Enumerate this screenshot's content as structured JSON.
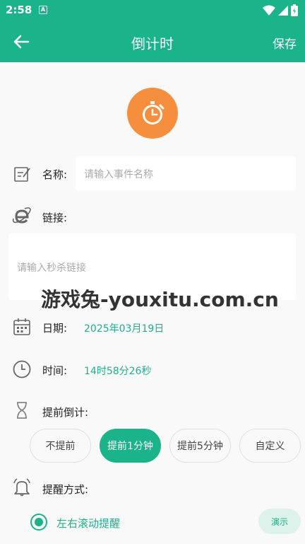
{
  "status_bar": {
    "time": "2:58",
    "notification_glyph": "A",
    "icons": [
      "wifi-icon",
      "signal-icon",
      "battery-icon"
    ]
  },
  "toolbar": {
    "title": "倒计时",
    "save_label": "保存"
  },
  "form": {
    "name": {
      "label": "名称:",
      "placeholder": "请输入事件名称"
    },
    "link": {
      "label": "链接:",
      "placeholder": "请输入秒杀链接"
    },
    "date": {
      "label": "日期:",
      "value": "2025年03月19日"
    },
    "time": {
      "label": "时间:",
      "value": "14时58分26秒"
    },
    "advance": {
      "label": "提前倒计:",
      "options": [
        "不提前",
        "提前1分钟",
        "提前5分钟",
        "自定义"
      ],
      "selected": "提前1分钟"
    },
    "remind": {
      "label": "提醒方式:",
      "option": "左右滚动提醒",
      "demo_label": "演示"
    }
  },
  "watermark": "游戏兔-youxitu.com.cn",
  "colors": {
    "accent": "#1ab38a",
    "clock_bg": "#f58e3d"
  }
}
